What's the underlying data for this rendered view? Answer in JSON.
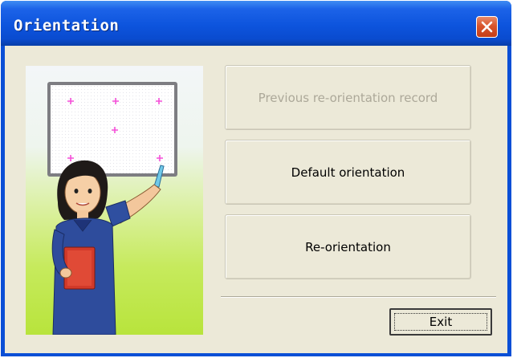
{
  "window": {
    "title": "Orientation"
  },
  "buttons": {
    "previous_record": "Previous re-orientation record",
    "default_orientation": "Default orientation",
    "reorientation": "Re-orientation",
    "exit": "Exit"
  },
  "illustration": {
    "description_icon": "teacher-pointing-at-board-icon",
    "marker_color": "#f54fd8"
  },
  "colors": {
    "titlebar": "#0d54dd",
    "client_bg": "#ece9d8",
    "close_button": "#d9552c",
    "disabled_text": "#aca899"
  }
}
